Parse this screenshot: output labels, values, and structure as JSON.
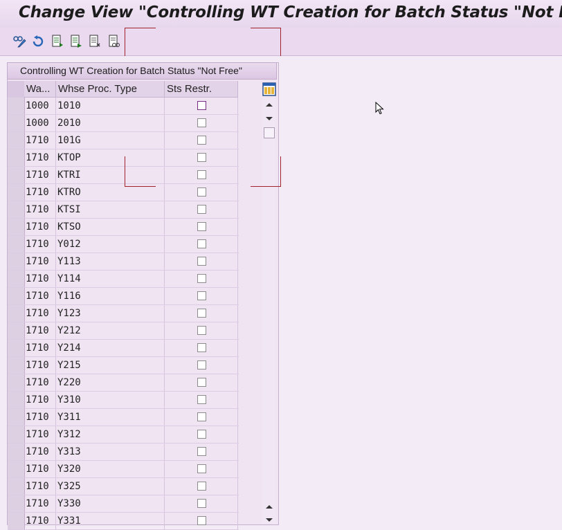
{
  "window": {
    "title": "Change View \"Controlling WT Creation for Batch Status \"Not Free\"\": Overview"
  },
  "toolbar": {
    "buttons": [
      {
        "icon": "display-change-icon"
      },
      {
        "icon": "undo-icon"
      },
      {
        "icon": "new-entries-icon"
      },
      {
        "icon": "copy-as-icon"
      },
      {
        "icon": "delete-icon"
      },
      {
        "icon": "select-all-icon"
      }
    ]
  },
  "panel": {
    "title": "Controlling WT Creation for Batch Status \"Not Free\""
  },
  "table": {
    "headers": {
      "warehouse": "Wa...",
      "type": "Whse Proc. Type",
      "status": "Sts Restr."
    },
    "rows": [
      {
        "wa": "1000",
        "type": "1010",
        "checked": false
      },
      {
        "wa": "1000",
        "type": "2010",
        "checked": false
      },
      {
        "wa": "1710",
        "type": "101G",
        "checked": false
      },
      {
        "wa": "1710",
        "type": "KTOP",
        "checked": false
      },
      {
        "wa": "1710",
        "type": "KTRI",
        "checked": false
      },
      {
        "wa": "1710",
        "type": "KTRO",
        "checked": false
      },
      {
        "wa": "1710",
        "type": "KTSI",
        "checked": false
      },
      {
        "wa": "1710",
        "type": "KTSO",
        "checked": false
      },
      {
        "wa": "1710",
        "type": "Y012",
        "checked": false
      },
      {
        "wa": "1710",
        "type": "Y113",
        "checked": false
      },
      {
        "wa": "1710",
        "type": "Y114",
        "checked": false
      },
      {
        "wa": "1710",
        "type": "Y116",
        "checked": false
      },
      {
        "wa": "1710",
        "type": "Y123",
        "checked": false
      },
      {
        "wa": "1710",
        "type": "Y212",
        "checked": false
      },
      {
        "wa": "1710",
        "type": "Y214",
        "checked": false
      },
      {
        "wa": "1710",
        "type": "Y215",
        "checked": false
      },
      {
        "wa": "1710",
        "type": "Y220",
        "checked": false
      },
      {
        "wa": "1710",
        "type": "Y310",
        "checked": false
      },
      {
        "wa": "1710",
        "type": "Y311",
        "checked": false
      },
      {
        "wa": "1710",
        "type": "Y312",
        "checked": false
      },
      {
        "wa": "1710",
        "type": "Y313",
        "checked": false
      },
      {
        "wa": "1710",
        "type": "Y320",
        "checked": false
      },
      {
        "wa": "1710",
        "type": "Y325",
        "checked": false
      },
      {
        "wa": "1710",
        "type": "Y330",
        "checked": false
      },
      {
        "wa": "1710",
        "type": "Y331",
        "checked": false
      }
    ]
  },
  "colors": {
    "background": "#f3ecf6",
    "toolbar": "#ead9ef",
    "accent_red": "#a0202b"
  }
}
